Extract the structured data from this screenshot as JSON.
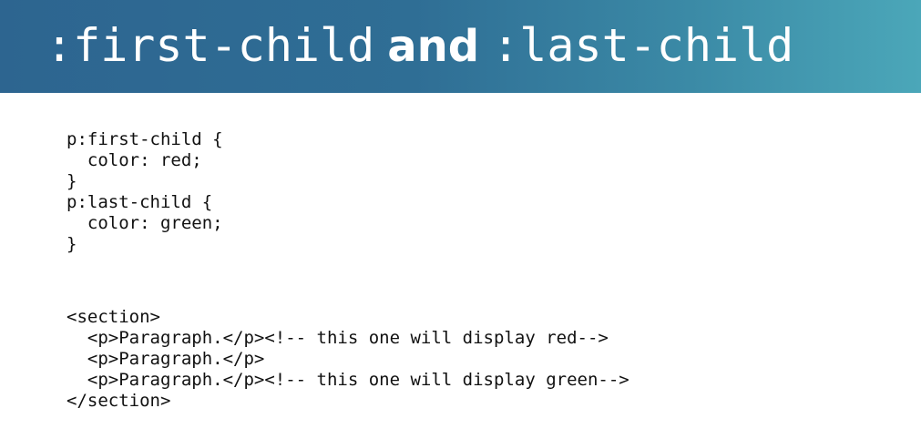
{
  "slide": {
    "title": {
      "part1": ":first-child",
      "connector": "and",
      "part2": ":last-child"
    },
    "css_code": [
      "p:first-child {",
      "  color: red;",
      "}",
      "p:last-child {",
      "  color: green;",
      "}"
    ],
    "html_code": [
      "<section>",
      "  <p>Paragraph.</p><!-- this one will display red-->",
      "  <p>Paragraph.</p>",
      "  <p>Paragraph.</p><!-- this one will display green-->",
      "</section>"
    ]
  },
  "colors": {
    "header_start": "#2d6590",
    "header_end": "#4ba7b9",
    "title_text": "#ffffff",
    "code_text": "#111111"
  }
}
